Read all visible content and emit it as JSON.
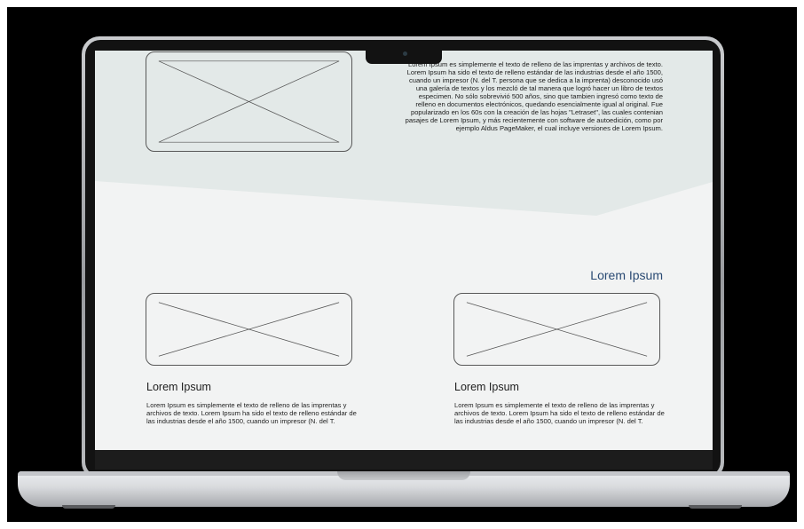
{
  "hero": {
    "text": "Lorem Ipsum es simplemente el texto de relleno de las imprentas y archivos de texto. Lorem Ipsum ha sido el texto de relleno estándar de las industrias desde el año 1500, cuando un impresor (N. del T. persona que se dedica a la imprenta) desconocido usó una galería de textos y los mezcló de tal manera que logró hacer un libro de textos especimen. No sólo sobrevivió 500 años, sino que tambien ingresó como texto de relleno en documentos electrónicos, quedando esencialmente igual al original. Fue popularizado en los 60s con la creación de las hojas \"Letraset\", las cuales contenian pasajes de Lorem Ipsum, y más recientemente con software de autoedición, como por ejemplo Aldus PageMaker, el cual incluye versiones de Lorem Ipsum."
  },
  "section": {
    "heading": "Lorem Ipsum"
  },
  "cards": [
    {
      "title": "Lorem Ipsum",
      "text": "Lorem Ipsum es simplemente el texto de relleno de las imprentas y archivos de texto. Lorem Ipsum ha sido el texto de relleno estándar de las industrias desde el año 1500, cuando un impresor (N. del T."
    },
    {
      "title": "Lorem Ipsum",
      "text": "Lorem Ipsum es simplemente el texto de relleno de las imprentas y archivos de texto. Lorem Ipsum ha sido el texto de relleno estándar de las industrias desde el año 1500, cuando un impresor (N. del T."
    }
  ],
  "colors": {
    "hero_background": "#e3e9e8",
    "page_background": "#f2f3f3",
    "heading_accent": "#2a4a73"
  }
}
